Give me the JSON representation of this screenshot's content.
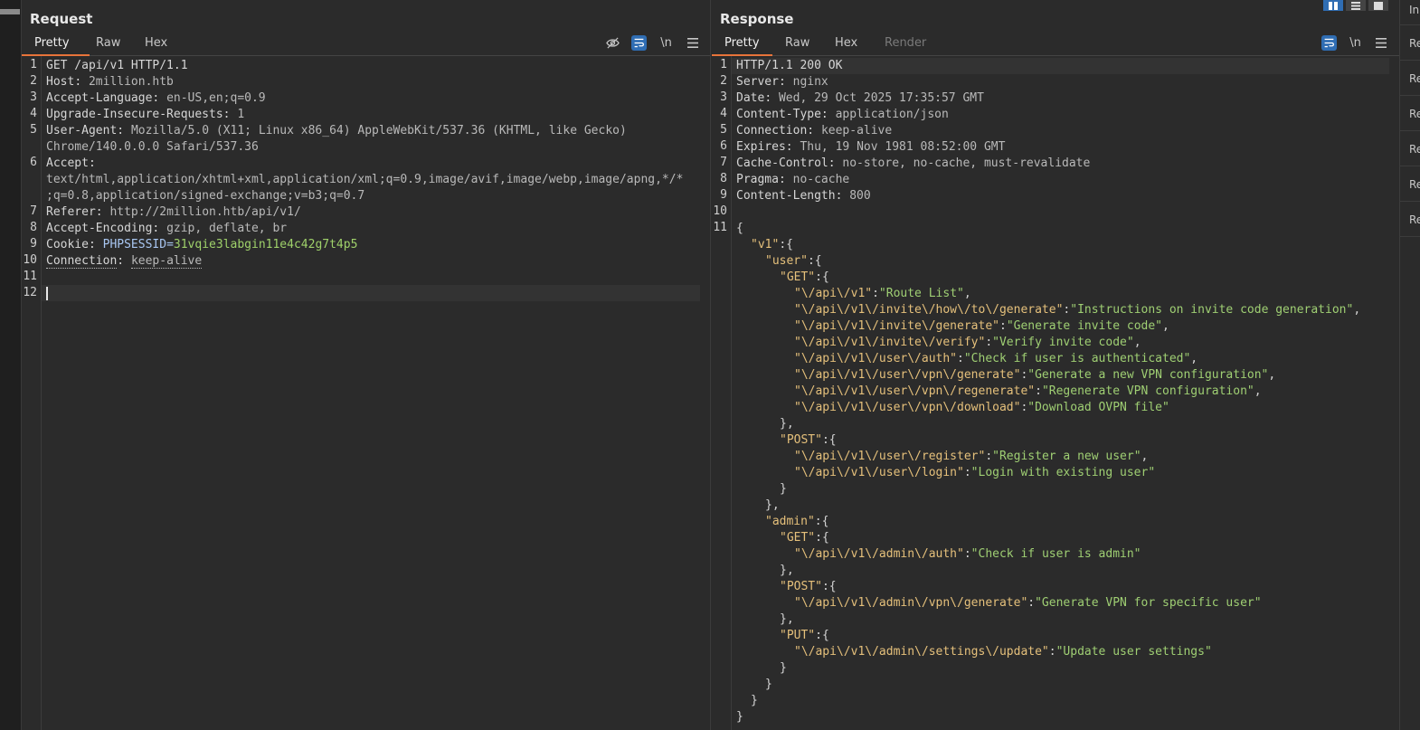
{
  "request": {
    "title": "Request",
    "tabs": [
      "Pretty",
      "Raw",
      "Hex"
    ],
    "tools": {
      "hide_icon": "eye-off-icon",
      "wrap_icon": "wrap-icon",
      "newline_label": "\\n",
      "menu_icon": "hamburger-icon"
    },
    "line_numbers": [
      "1",
      "2",
      "3",
      "4",
      "5",
      "",
      "6",
      "",
      "",
      "7",
      "8",
      "9",
      "10",
      "11",
      "12"
    ],
    "lines": [
      {
        "key": "GET /api/v1 HTTP/1.1",
        "val": ""
      },
      {
        "key": "Host",
        "val": "2million.htb"
      },
      {
        "key": "Accept-Language",
        "val": "en-US,en;q=0.9"
      },
      {
        "key": "Upgrade-Insecure-Requests",
        "val": "1"
      },
      {
        "key": "User-Agent",
        "val": "Mozilla/5.0 (X11; Linux x86_64) AppleWebKit/537.36 (KHTML, like Gecko)"
      },
      {
        "key": "",
        "val": "Chrome/140.0.0.0 Safari/537.36"
      },
      {
        "key": "Accept",
        "val": ""
      },
      {
        "key": "",
        "val": "text/html,application/xhtml+xml,application/xml;q=0.9,image/avif,image/webp,image/apng,*/*"
      },
      {
        "key": "",
        "val": ";q=0.8,application/signed-exchange;v=b3;q=0.7"
      },
      {
        "key": "Referer",
        "val": "http://2million.htb/api/v1/"
      },
      {
        "key": "Accept-Encoding",
        "val": "gzip, deflate, br"
      },
      {
        "key": "Cookie",
        "val": ""
      },
      {
        "key": "Connection",
        "val": "keep-alive"
      },
      {
        "key": "",
        "val": ""
      },
      {
        "key": "",
        "val": ""
      }
    ],
    "cookie_name": "PHPSESSID=",
    "cookie_value": "31vqie3labgin11e4c42g7t4p5"
  },
  "response": {
    "title": "Response",
    "tabs": [
      "Pretty",
      "Raw",
      "Hex",
      "Render"
    ],
    "tools": {
      "wrap_icon": "wrap-icon",
      "newline_label": "\\n",
      "menu_icon": "hamburger-icon"
    },
    "line_numbers": [
      "1",
      "2",
      "3",
      "4",
      "5",
      "6",
      "7",
      "8",
      "9",
      "10",
      "11"
    ],
    "headers": [
      {
        "key": "HTTP/1.1 200 OK",
        "val": ""
      },
      {
        "key": "Server",
        "val": "nginx"
      },
      {
        "key": "Date",
        "val": "Wed, 29 Oct 2025 17:35:57 GMT"
      },
      {
        "key": "Content-Type",
        "val": "application/json"
      },
      {
        "key": "Connection",
        "val": "keep-alive"
      },
      {
        "key": "Expires",
        "val": "Thu, 19 Nov 1981 08:52:00 GMT"
      },
      {
        "key": "Cache-Control",
        "val": "no-store, no-cache, must-revalidate"
      },
      {
        "key": "Pragma",
        "val": "no-cache"
      },
      {
        "key": "Content-Length",
        "val": "800"
      },
      {
        "key": "",
        "val": ""
      }
    ],
    "json_lines": [
      {
        "indent": 0,
        "key": "",
        "str": "",
        "tail": "{"
      },
      {
        "indent": 1,
        "key": "\"v1\"",
        "str": "",
        "tail": ":{"
      },
      {
        "indent": 2,
        "key": "\"user\"",
        "str": "",
        "tail": ":{"
      },
      {
        "indent": 3,
        "key": "\"GET\"",
        "str": "",
        "tail": ":{"
      },
      {
        "indent": 4,
        "key": "\"\\/api\\/v1\"",
        "str": "\"Route List\"",
        "tail": ","
      },
      {
        "indent": 4,
        "key": "\"\\/api\\/v1\\/invite\\/how\\/to\\/generate\"",
        "str": "\"Instructions on invite code generation\"",
        "tail": ","
      },
      {
        "indent": 4,
        "key": "\"\\/api\\/v1\\/invite\\/generate\"",
        "str": "\"Generate invite code\"",
        "tail": ","
      },
      {
        "indent": 4,
        "key": "\"\\/api\\/v1\\/invite\\/verify\"",
        "str": "\"Verify invite code\"",
        "tail": ","
      },
      {
        "indent": 4,
        "key": "\"\\/api\\/v1\\/user\\/auth\"",
        "str": "\"Check if user is authenticated\"",
        "tail": ","
      },
      {
        "indent": 4,
        "key": "\"\\/api\\/v1\\/user\\/vpn\\/generate\"",
        "str": "\"Generate a new VPN configuration\"",
        "tail": ","
      },
      {
        "indent": 4,
        "key": "\"\\/api\\/v1\\/user\\/vpn\\/regenerate\"",
        "str": "\"Regenerate VPN configuration\"",
        "tail": ","
      },
      {
        "indent": 4,
        "key": "\"\\/api\\/v1\\/user\\/vpn\\/download\"",
        "str": "\"Download OVPN file\"",
        "tail": ""
      },
      {
        "indent": 3,
        "key": "",
        "str": "",
        "tail": "},"
      },
      {
        "indent": 3,
        "key": "\"POST\"",
        "str": "",
        "tail": ":{"
      },
      {
        "indent": 4,
        "key": "\"\\/api\\/v1\\/user\\/register\"",
        "str": "\"Register a new user\"",
        "tail": ","
      },
      {
        "indent": 4,
        "key": "\"\\/api\\/v1\\/user\\/login\"",
        "str": "\"Login with existing user\"",
        "tail": ""
      },
      {
        "indent": 3,
        "key": "",
        "str": "",
        "tail": "}"
      },
      {
        "indent": 2,
        "key": "",
        "str": "",
        "tail": "},"
      },
      {
        "indent": 2,
        "key": "\"admin\"",
        "str": "",
        "tail": ":{"
      },
      {
        "indent": 3,
        "key": "\"GET\"",
        "str": "",
        "tail": ":{"
      },
      {
        "indent": 4,
        "key": "\"\\/api\\/v1\\/admin\\/auth\"",
        "str": "\"Check if user is admin\"",
        "tail": ""
      },
      {
        "indent": 3,
        "key": "",
        "str": "",
        "tail": "},"
      },
      {
        "indent": 3,
        "key": "\"POST\"",
        "str": "",
        "tail": ":{"
      },
      {
        "indent": 4,
        "key": "\"\\/api\\/v1\\/admin\\/vpn\\/generate\"",
        "str": "\"Generate VPN for specific user\"",
        "tail": ""
      },
      {
        "indent": 3,
        "key": "",
        "str": "",
        "tail": "},"
      },
      {
        "indent": 3,
        "key": "\"PUT\"",
        "str": "",
        "tail": ":{"
      },
      {
        "indent": 4,
        "key": "\"\\/api\\/v1\\/admin\\/settings\\/update\"",
        "str": "\"Update user settings\"",
        "tail": ""
      },
      {
        "indent": 3,
        "key": "",
        "str": "",
        "tail": "}"
      },
      {
        "indent": 2,
        "key": "",
        "str": "",
        "tail": "}"
      },
      {
        "indent": 1,
        "key": "",
        "str": "",
        "tail": "}"
      },
      {
        "indent": 0,
        "key": "",
        "str": "",
        "tail": "}"
      }
    ]
  },
  "right_rail": {
    "top": "In",
    "items": [
      "Re",
      "Re",
      "Re",
      "Re",
      "Re",
      "Re"
    ]
  },
  "layout_buttons": [
    "split-horizontal-icon",
    "split-vertical-icon",
    "single-pane-icon"
  ],
  "colors": {
    "accent": "#e8733a",
    "selected_blue": "#2f6db3",
    "json_key": "#e5c07b",
    "json_string": "#9fcf73",
    "cookie_value": "#9fd16a"
  }
}
